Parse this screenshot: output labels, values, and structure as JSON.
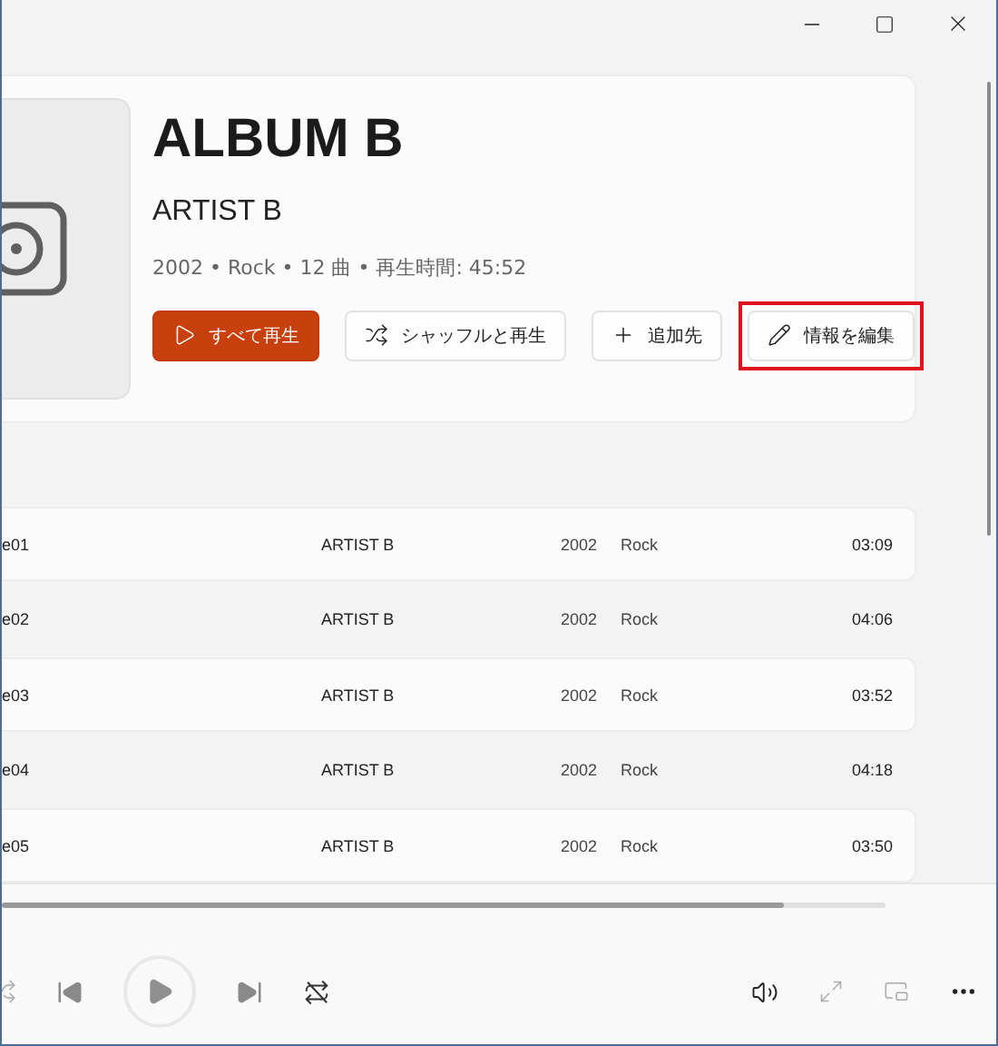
{
  "album": {
    "title": "ALBUM B",
    "artist": "ARTIST B",
    "meta": "2002 • Rock • 12 曲 • 再生時間: 45:52"
  },
  "actions": [
    {
      "kind": "play",
      "label": "すべて再生",
      "primary": true,
      "highlighted": false
    },
    {
      "kind": "shuffle",
      "label": "シャッフルと再生",
      "primary": false,
      "highlighted": false
    },
    {
      "kind": "add",
      "label": "追加先",
      "primary": false,
      "highlighted": false
    },
    {
      "kind": "edit",
      "label": "情報を編集",
      "primary": false,
      "highlighted": true
    }
  ],
  "tracks": [
    {
      "title": "e01",
      "artist": "ARTIST B",
      "year": "2002",
      "genre": "Rock",
      "duration": "03:09"
    },
    {
      "title": "e02",
      "artist": "ARTIST B",
      "year": "2002",
      "genre": "Rock",
      "duration": "04:06"
    },
    {
      "title": "e03",
      "artist": "ARTIST B",
      "year": "2002",
      "genre": "Rock",
      "duration": "03:52"
    },
    {
      "title": "e04",
      "artist": "ARTIST B",
      "year": "2002",
      "genre": "Rock",
      "duration": "04:18"
    },
    {
      "title": "e05",
      "artist": "ARTIST B",
      "year": "2002",
      "genre": "Rock",
      "duration": "03:50"
    }
  ],
  "player": {
    "level": 0.885
  }
}
